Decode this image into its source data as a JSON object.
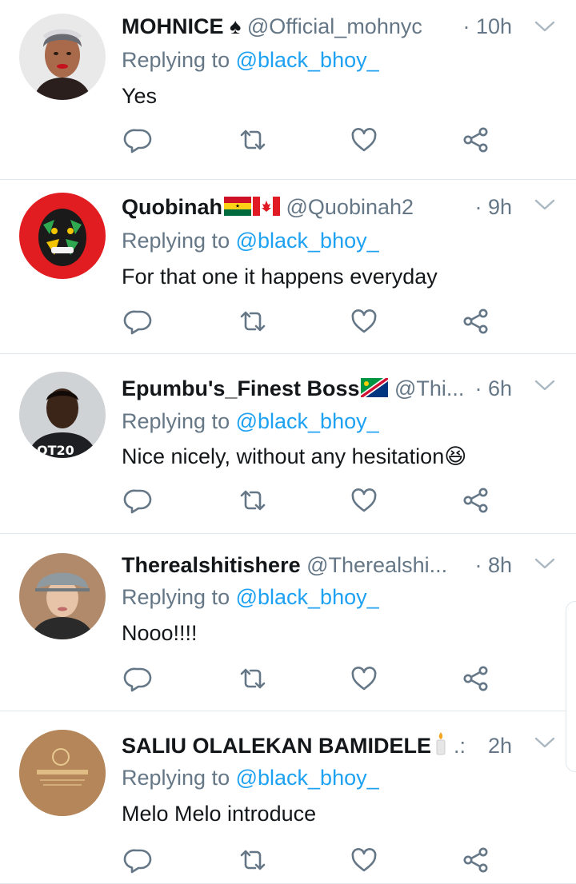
{
  "reply_prefix": "Replying to ",
  "tweets": [
    {
      "name": "MOHNICE ♠",
      "handle": "@Official_mohnyc",
      "time": "· 10h",
      "replying_to": "@black_bhoy_",
      "text": "Yes"
    },
    {
      "name": "Quobinah",
      "flags": [
        "ghana-flag",
        "canada-flag"
      ],
      "handle": "@Quobinah2",
      "time": "· 9h",
      "replying_to": "@black_bhoy_",
      "text": "For that one it happens everyday"
    },
    {
      "name": "Epumbu's_Finest Boss",
      "flags": [
        "namibia-flag"
      ],
      "handle": "@Thi...",
      "time": "· 6h",
      "replying_to": "@black_bhoy_",
      "text": "Nice nicely, without any hesitation😆"
    },
    {
      "name": "Therealshitishere",
      "handle": "@Therealshi...",
      "time": "· 8h",
      "replying_to": "@black_bhoy_",
      "text": "Nooo!!!!"
    },
    {
      "name": "SALIU OLALEKAN BAMIDELE",
      "emoji": "candle-icon",
      "handle": ".:",
      "time": "2h",
      "replying_to": "@black_bhoy_",
      "text": "Melo Melo introduce"
    }
  ],
  "colors": {
    "link": "#1da1f2",
    "muted": "#657786",
    "divider": "#e1e8ed",
    "icon": "#657786"
  }
}
